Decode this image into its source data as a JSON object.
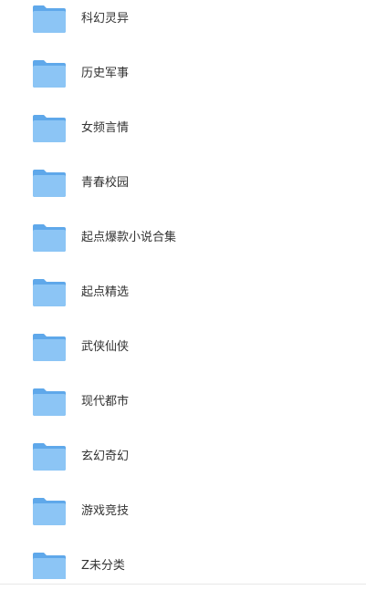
{
  "folders": [
    {
      "name": "科幻灵异",
      "icon": "folder-icon"
    },
    {
      "name": "历史军事",
      "icon": "folder-icon"
    },
    {
      "name": "女频言情",
      "icon": "folder-icon"
    },
    {
      "name": "青春校园",
      "icon": "folder-icon"
    },
    {
      "name": "起点爆款小说合集",
      "icon": "folder-icon"
    },
    {
      "name": "起点精选",
      "icon": "folder-icon"
    },
    {
      "name": "武侠仙侠",
      "icon": "folder-icon"
    },
    {
      "name": "现代都市",
      "icon": "folder-icon"
    },
    {
      "name": "玄幻奇幻",
      "icon": "folder-icon"
    },
    {
      "name": "游戏竞技",
      "icon": "folder-icon"
    },
    {
      "name": "Z未分类",
      "icon": "folder-icon"
    }
  ],
  "colors": {
    "folder_front": "#8cc5f5",
    "folder_back": "#5fa8ea",
    "folder_tab": "#5fa8ea",
    "text": "#333333"
  }
}
